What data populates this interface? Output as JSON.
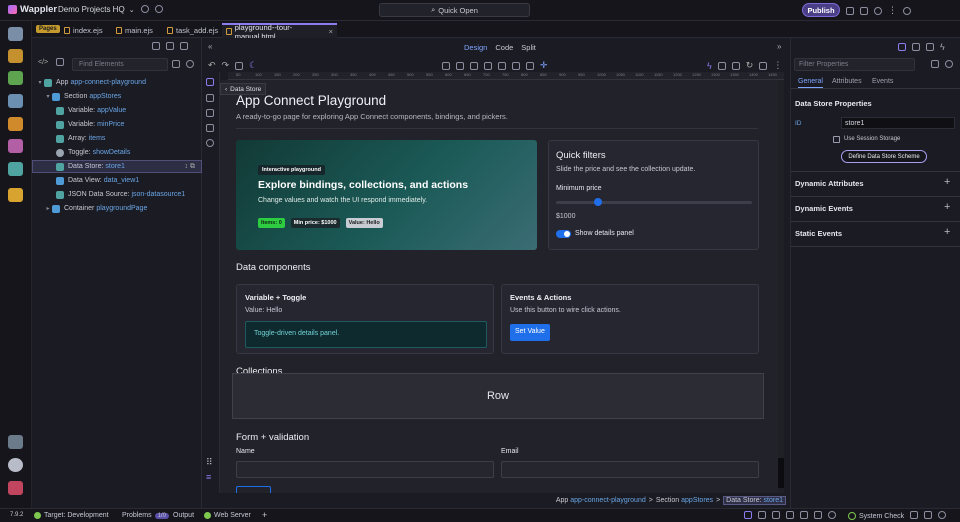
{
  "topbar": {
    "app_name": "Wappler",
    "project": "Demo Projects HQ",
    "quick_open": "Quick Open",
    "publish": "Publish"
  },
  "tabs": {
    "pages_badge": "Pages",
    "items": [
      "index.ejs",
      "main.ejs",
      "task_add.ejs",
      "playground--tour-manual.html"
    ]
  },
  "left_panel": {
    "find_placeholder": "Find Elements",
    "tree": [
      {
        "label": "App",
        "id": "app-connect-playground"
      },
      {
        "label": "Section",
        "id": "appStores"
      },
      {
        "label": "Variable:",
        "id": "appValue"
      },
      {
        "label": "Variable:",
        "id": "minPrice"
      },
      {
        "label": "Array:",
        "id": "items"
      },
      {
        "label": "Toggle:",
        "id": "showDetails"
      },
      {
        "label": "Data Store:",
        "id": "store1"
      },
      {
        "label": "Data View:",
        "id": "data_view1"
      },
      {
        "label": "JSON Data Source:",
        "id": "json-datasource1"
      },
      {
        "label": "Container",
        "id": "playgroundPage"
      }
    ]
  },
  "view_modes": {
    "design": "Design",
    "code": "Code",
    "split": "Split"
  },
  "ruler_labels": [
    "50",
    "100",
    "150",
    "200",
    "250",
    "300",
    "350",
    "400",
    "450",
    "500",
    "550",
    "600",
    "650",
    "700",
    "750",
    "800",
    "850",
    "900",
    "950",
    "1000",
    "1050",
    "1100",
    "1150",
    "1200",
    "1250",
    "1300",
    "1350",
    "1400",
    "1450"
  ],
  "canvas": {
    "element_tag": "Data Store",
    "title": "App Connect Playground",
    "subtitle": "A ready-to-go page for exploring App Connect components, bindings, and pickers.",
    "hero": {
      "pill": "Interactive playground",
      "heading": "Explore bindings, collections, and actions",
      "text": "Change values and watch the UI respond immediately.",
      "badges": [
        "Items: 0",
        "Min price: $1000",
        "Value: Hello"
      ]
    },
    "quick_filters": {
      "heading": "Quick filters",
      "text": "Slide the price and see the collection update.",
      "min_price_label": "Minimum price",
      "slider_value": 0.2,
      "price_value": "$1000",
      "toggle_label": "Show details panel"
    },
    "data_components": {
      "heading": "Data components",
      "variable_card": {
        "title": "Variable + Toggle",
        "value": "Value: Hello",
        "panel_text": "Toggle-driven details panel."
      },
      "events_card": {
        "title": "Events & Actions",
        "text": "Use this button to wire click actions.",
        "button": "Set Value"
      }
    },
    "collections_heading": "Collections",
    "row_label": "Row",
    "form": {
      "heading": "Form + validation",
      "name_label": "Name",
      "email_label": "Email"
    }
  },
  "breadcrumb": {
    "app": "App",
    "app_id": "app-connect-playground",
    "sep": ">",
    "section": "Section",
    "section_id": "appStores",
    "current": "Data Store:",
    "current_id": "store1"
  },
  "right_panel": {
    "filter_placeholder": "Filter Properties",
    "tabs": [
      "General",
      "Attributes",
      "Events"
    ],
    "section_title": "Data Store Properties",
    "id_label": "ID",
    "id_value": "store1",
    "session_label": "Use Session Storage",
    "define_button": "Define Data Store Scheme",
    "sections": [
      "Dynamic Attributes",
      "Dynamic Events",
      "Static Events"
    ]
  },
  "status": {
    "version": "7.9.2",
    "target": "Target: Development",
    "problems": "Problems",
    "problems_count": "1/0",
    "output": "Output",
    "web_server": "Web Server",
    "system_check": "System Check"
  },
  "colors": {
    "accent": "#7b6bd6",
    "link": "#6aa6e6",
    "primary_btn": "#1f6feb",
    "success": "#2ecc40"
  }
}
